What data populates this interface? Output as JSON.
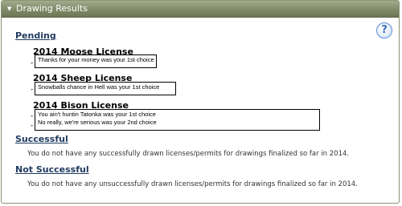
{
  "panel": {
    "title": "Drawing Results",
    "collapse_glyph": "▼",
    "help_glyph": "?"
  },
  "pending": {
    "heading": "Pending",
    "licenses": [
      {
        "title": "2014 Moose License",
        "results": [
          "Thanks for your money was your 1st choice"
        ]
      },
      {
        "title": "2014 Sheep License",
        "results": [
          "Snowballs chance in Hell was your 1st choice"
        ]
      },
      {
        "title": "2014 Bison License",
        "results": [
          "You ain't huntin Tatonka was your 1st choice",
          "No really, we're serious was your 2nd choice"
        ]
      }
    ]
  },
  "successful": {
    "heading": "Successful",
    "message": "You do not have any successfully drawn licenses/permits for drawings finalized so far in 2014."
  },
  "not_successful": {
    "heading": "Not Successful",
    "message": "You do not have any unsuccessfully drawn licenses/permits for drawings finalized so far in 2014."
  },
  "bullet": "-"
}
